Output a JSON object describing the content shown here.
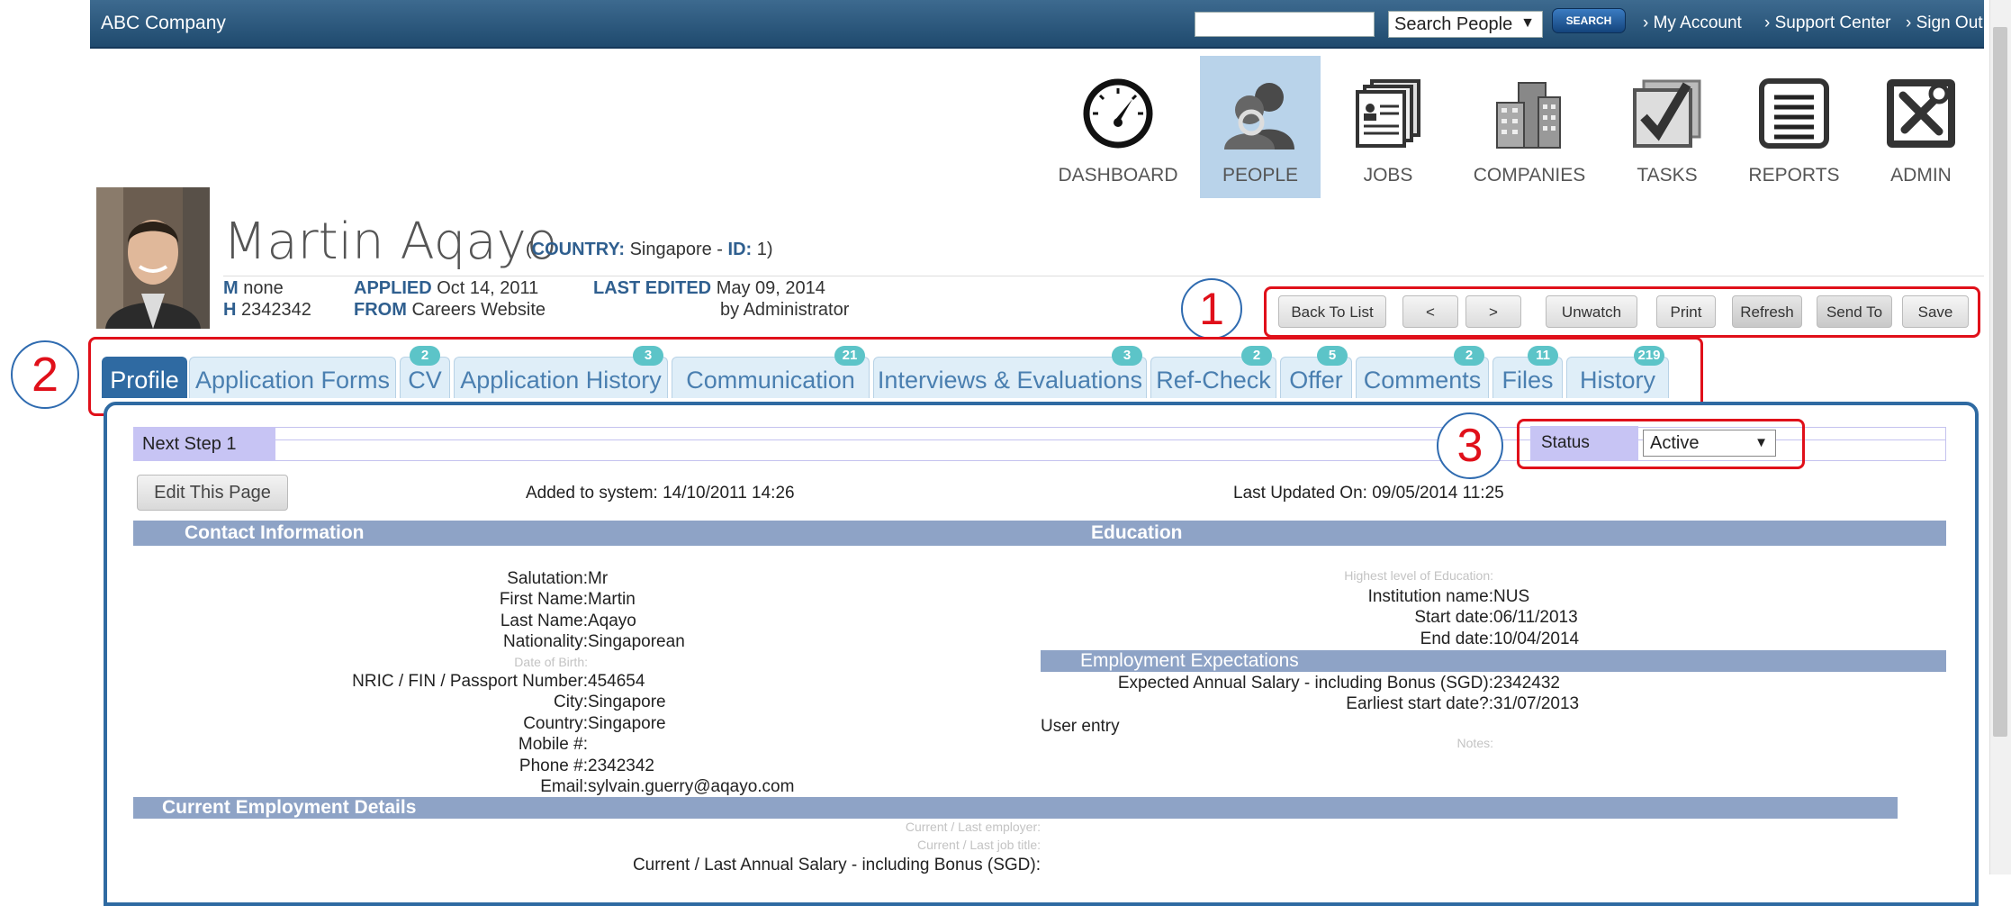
{
  "topbar": {
    "company": "ABC Company",
    "search_select": "Search People",
    "search_button": "SEARCH",
    "links": [
      "› My Account",
      "› Support Center",
      "› Sign Out"
    ]
  },
  "modules": [
    {
      "label": "DASHBOARD",
      "icon": "gauge-icon"
    },
    {
      "label": "PEOPLE",
      "icon": "people-icon",
      "active": true
    },
    {
      "label": "JOBS",
      "icon": "documents-icon"
    },
    {
      "label": "COMPANIES",
      "icon": "buildings-icon"
    },
    {
      "label": "TASKS",
      "icon": "checkmark-icon"
    },
    {
      "label": "REPORTS",
      "icon": "report-icon"
    },
    {
      "label": "ADMIN",
      "icon": "tools-icon"
    }
  ],
  "profile": {
    "name": "Martin Aqayo",
    "country_label": "COUNTRY:",
    "country": "Singapore",
    "id_label": "ID:",
    "id": "1",
    "m_label": "M",
    "m_value": "none",
    "h_label": "H",
    "h_value": "2342342",
    "applied_label": "APPLIED",
    "applied_value": "Oct 14, 2011",
    "from_label": "FROM",
    "from_value": "Careers Website",
    "last_edited_label": "LAST EDITED",
    "last_edited_value": "May 09, 2014",
    "edited_by": "by Administrator"
  },
  "actions": [
    "Back To List",
    "<",
    ">",
    "Unwatch",
    "Print",
    "Refresh",
    "Send To",
    "Save"
  ],
  "annotations": [
    "1",
    "2",
    "3"
  ],
  "tabs": [
    {
      "label": "Profile",
      "badge": ""
    },
    {
      "label": "Application Forms",
      "badge": ""
    },
    {
      "label": "CV",
      "badge": "2"
    },
    {
      "label": "Application History",
      "badge": "3"
    },
    {
      "label": "Communication",
      "badge": "21"
    },
    {
      "label": "Interviews & Evaluations",
      "badge": "3"
    },
    {
      "label": "Ref-Check",
      "badge": "2"
    },
    {
      "label": "Offer",
      "badge": "5"
    },
    {
      "label": "Comments",
      "badge": "2"
    },
    {
      "label": "Files",
      "badge": "11"
    },
    {
      "label": "History",
      "badge": "219"
    }
  ],
  "panel": {
    "next_step": "Next Step 1",
    "status_label": "Status",
    "status_value": "Active",
    "edit_button": "Edit This Page",
    "added": "Added to system: 14/10/2011 14:26",
    "updated": "Last Updated On: 09/05/2014 11:25"
  },
  "contact": {
    "title": "Contact Information",
    "salutation_k": "Salutation:",
    "salutation_v": "Mr",
    "first_k": "First Name:",
    "first_v": "Martin",
    "last_k": "Last Name:",
    "last_v": "Aqayo",
    "nat_k": "Nationality:",
    "nat_v": "Singaporean",
    "dob_k": "Date of Birth:",
    "nric_k": "NRIC / FIN / Passport Number:",
    "nric_v": "454654",
    "city_k": "City:",
    "city_v": "Singapore",
    "country_k": "Country:",
    "country_v": "Singapore",
    "mobile_k": "Mobile #:",
    "phone_k": "Phone #:",
    "phone_v": "2342342",
    "email_k": "Email:",
    "email_v": "sylvain.guerry@aqayo.com"
  },
  "education": {
    "title": "Education",
    "level_k": "Highest level of Education:",
    "inst_k": "Institution name:",
    "inst_v": "NUS",
    "start_k": "Start date:",
    "start_v": "06/11/2013",
    "end_k": "End date:",
    "end_v": "10/04/2014"
  },
  "expectations": {
    "title": "Employment Expectations",
    "salary_k": "Expected Annual Salary - including Bonus (SGD):",
    "salary_v": "2342432",
    "earliest_k": "Earliest start date?:",
    "earliest_v": "31/07/2013",
    "user_entry": "User entry",
    "notes_k": "Notes:"
  },
  "employment": {
    "title": "Current Employment Details",
    "employer_k": "Current / Last employer:",
    "jobtitle_k": "Current / Last job title:",
    "salary_k": "Current / Last Annual Salary - including Bonus (SGD):"
  }
}
